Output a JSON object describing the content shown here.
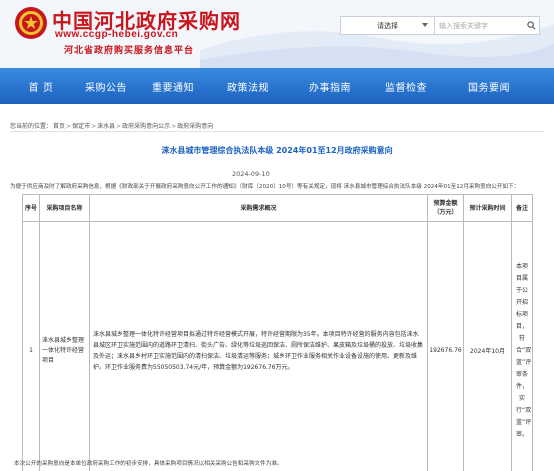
{
  "header": {
    "site_title": "中国河北政府采购网",
    "site_url": "www.ccgp-hebei.gov.cn",
    "site_subtitle": "河北省政府购买服务信息平台",
    "search_select": "请选择",
    "search_placeholder": "输入搜索关键字"
  },
  "nav": [
    {
      "label": "首 页"
    },
    {
      "label": "采购公告"
    },
    {
      "label": "重要通知"
    },
    {
      "label": "政策法规"
    },
    {
      "label": "办事指南"
    },
    {
      "label": "监督检查"
    },
    {
      "label": "国务要闻"
    }
  ],
  "breadcrumb": {
    "prefix": "您当前的位置：",
    "items": [
      "首页",
      "保定市",
      "涞水县",
      "政府采购意向公示",
      "政府采购意向"
    ]
  },
  "doc": {
    "title": "涞水县城市管理综合执法队本级 2024年01至12月政府采购意向",
    "date": "2024-09-10",
    "intro": "为便于供应商及时了解政府采购信息，根据《财政部关于开展政府采购意向公开工作的通知》（财库〔2020〕10号）等有关规定，现将 涞水县城市管理综合执法队本级 2024年01至12月采购意向公开如下：",
    "footnote": "本次公开的采购意向是本单位政府采购工作的初步安排，具体采购项目情况以相关采购公告和采购文件为准。"
  },
  "table": {
    "headers": {
      "seq": "序号",
      "name": "采购项目名称",
      "desc": "采购需求概况",
      "amount": "预算金额（万元）",
      "time": "预计采购时间",
      "note": "备注"
    },
    "rows": [
      {
        "seq": "1",
        "name": "涞水县城乡整理一体化特许经营项目",
        "desc": "涞水县城乡整理一体化特许经营项目拟通过特许经营模式开展，特许经营期限为35年。本项目特许经营的服务内容包括涞水县城区环卫实施范围内的道路环卫清扫、街头广告、绿化等垃圾巡回保洁、厕所保洁维护、果皮箱及垃圾桶的投放、垃圾收集及外运；涞水县乡村环卫实施范围内的清扫保洁、垃圾清运等服务；城乡环卫作业服务相关作业设备设施的使用、更新及维护。环卫作业服务费为55050503.74元/年，预算金额为192676.76万元。",
        "amount": "192676.76",
        "time": "2024年10月",
        "note": "本项目属于公开招标项目，符合“双蓝”评审条件，实行“双蓝”评审。"
      }
    ]
  },
  "colors": {
    "brand_red": "#c8161d",
    "nav_blue": "#1c62c0",
    "title_blue": "#1c62c0"
  },
  "icons": {
    "logo": "state-emblem-icon",
    "search": "search-icon",
    "dropdown": "chevron-down-icon"
  }
}
